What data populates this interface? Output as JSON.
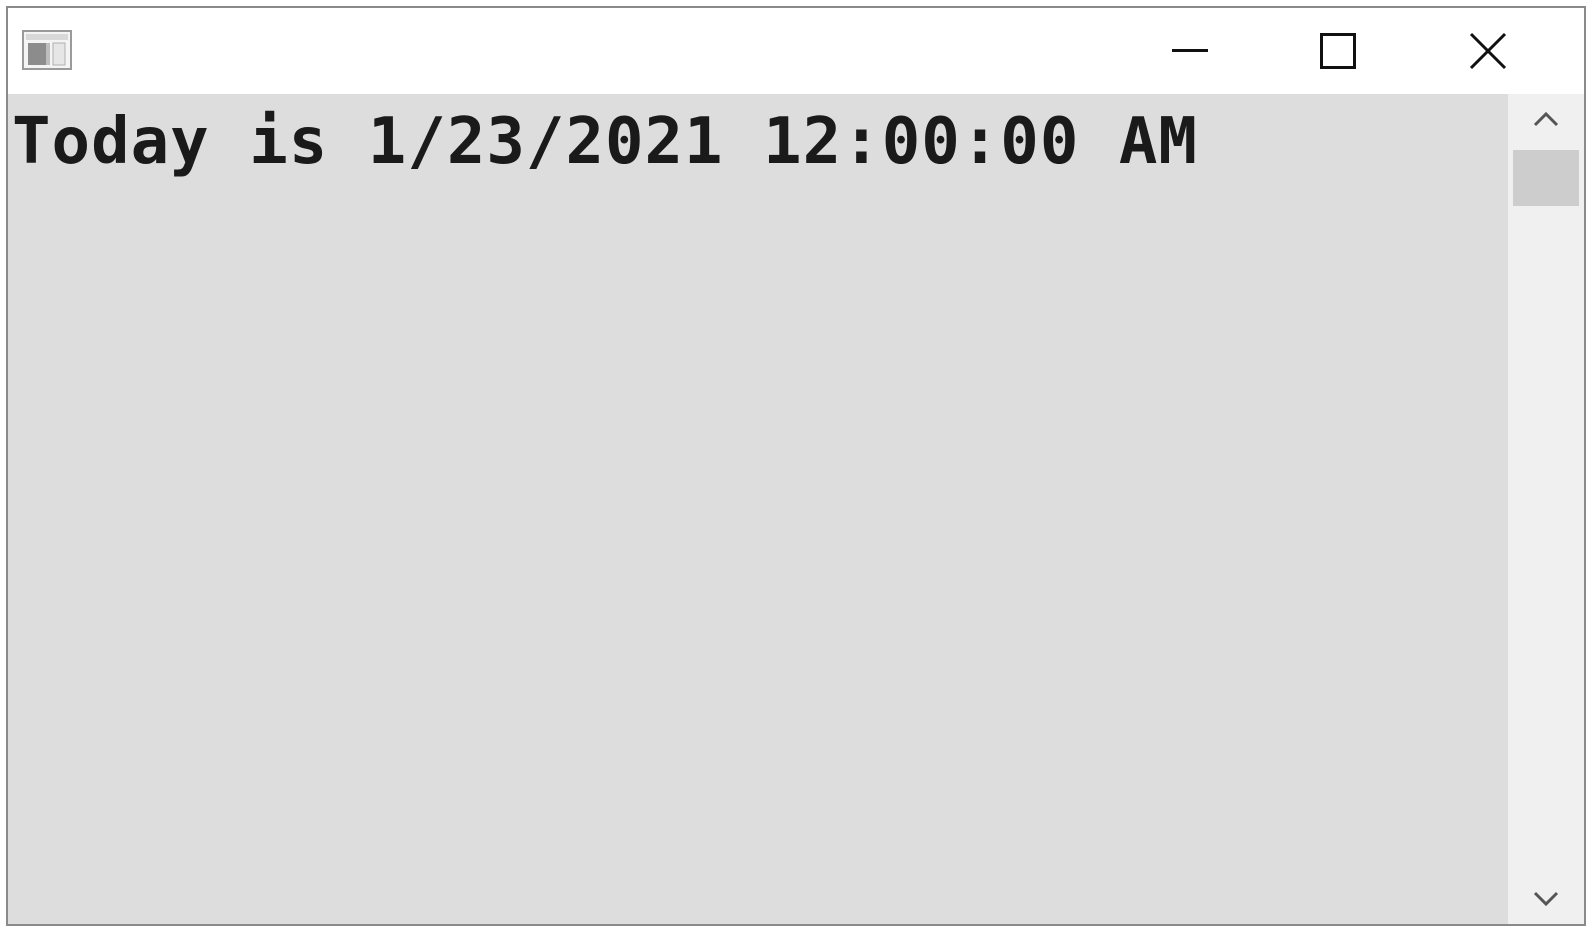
{
  "window": {
    "icon": "console-app-icon",
    "buttons": {
      "minimize": "minimize-icon",
      "maximize": "maximize-icon",
      "close": "close-icon"
    }
  },
  "console": {
    "lines": [
      "Today is 1/23/2021 12:00:00 AM"
    ]
  },
  "scrollbar": {
    "up_icon": "chevron-up-icon",
    "down_icon": "chevron-down-icon"
  },
  "colors": {
    "content_background": "#dddddd",
    "text": "#1a1a1a",
    "scrollbar_track": "#f0f0f0",
    "scrollbar_thumb": "#cdcdcd"
  }
}
